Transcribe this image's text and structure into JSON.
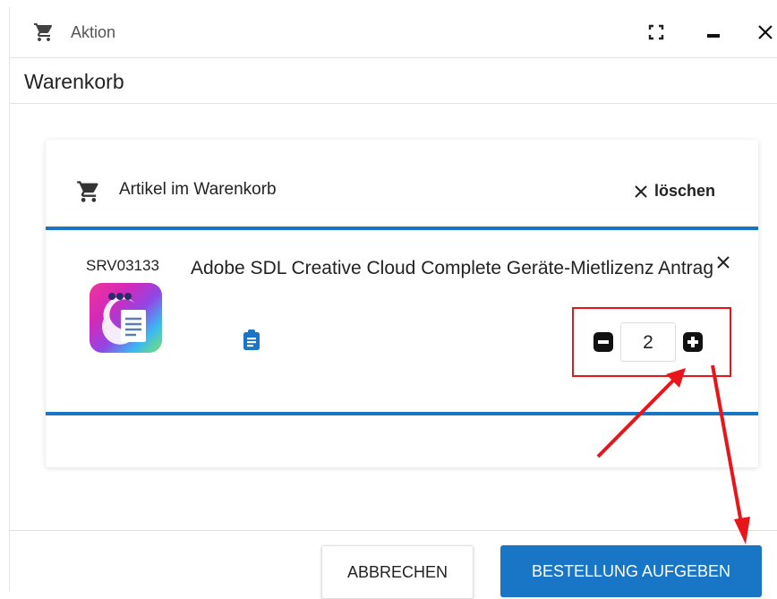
{
  "window": {
    "title": "Aktion",
    "icons": {
      "cart": "cart-icon",
      "fullscreen": "fullscreen-icon",
      "minimize": "minimize-icon",
      "close": "close-icon"
    }
  },
  "page": {
    "heading": "Warenkorb"
  },
  "cart": {
    "header_label": "Artikel im Warenkorb",
    "clear_label": "löschen",
    "item": {
      "id": "SRV03133",
      "name": "Adobe SDL Creative Cloud Complete Geräte-Mietlizenz Antrag",
      "quantity": "2",
      "icons": {
        "details": "clipboard-icon",
        "remove": "close-icon",
        "decrease": "minus-icon",
        "increase": "plus-icon"
      }
    }
  },
  "footer": {
    "cancel_label": "ABBRECHEN",
    "submit_label": "BESTELLUNG AUFGEBEN"
  },
  "colors": {
    "accent": "#1976c6",
    "annotation": "#e8151b"
  }
}
